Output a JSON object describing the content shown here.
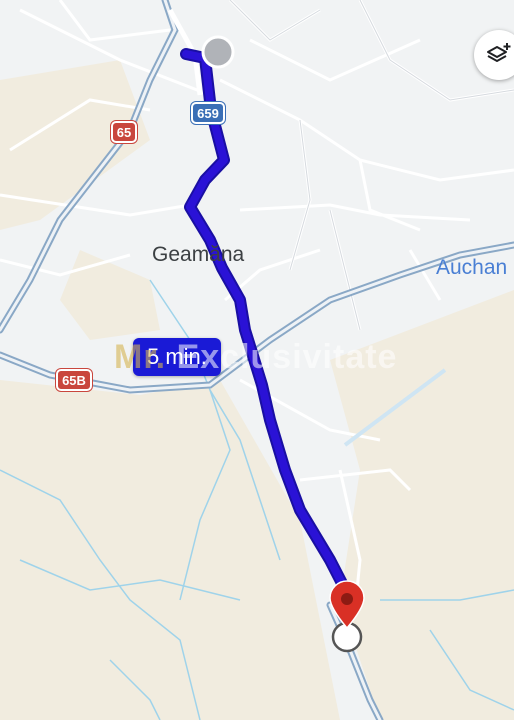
{
  "map": {
    "place_label": "Geamăna",
    "poi_label": "Auchan",
    "route_duration": "5 min.",
    "watermark": {
      "prefix": "Mr.",
      "text": "Exclusivitate"
    },
    "road_shields": [
      {
        "id": "65",
        "label": "65",
        "style": "national-red"
      },
      {
        "id": "65B",
        "label": "65B",
        "style": "national-red"
      },
      {
        "id": "659",
        "label": "659",
        "style": "county-blue"
      }
    ],
    "colors": {
      "route": "#2a12d6",
      "destination_pin": "#d93025",
      "major_road": "#8aa8c6",
      "water": "#9fd3ea",
      "farmland": "#f1ecdf",
      "background": "#f1f3f4"
    },
    "controls": {
      "layers_icon": "layers-icon"
    }
  }
}
